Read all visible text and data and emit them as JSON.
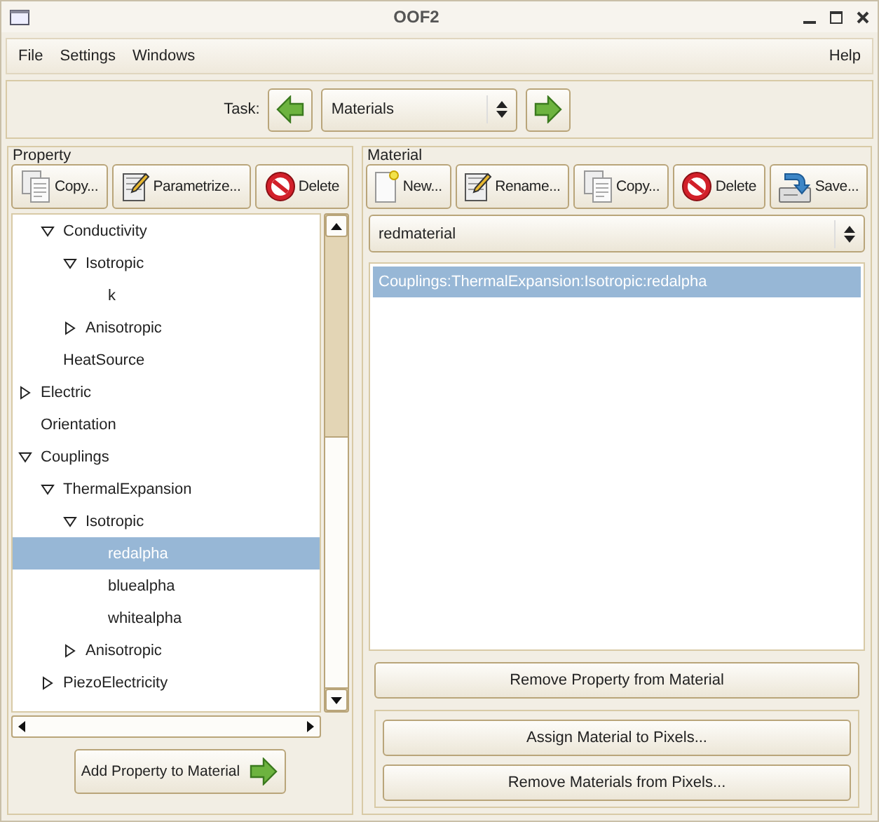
{
  "window": {
    "title": "OOF2"
  },
  "menu": {
    "left": [
      "File",
      "Settings",
      "Windows"
    ],
    "right": [
      "Help"
    ]
  },
  "task": {
    "label": "Task:",
    "value": "Materials"
  },
  "property": {
    "title": "Property",
    "buttons": [
      {
        "label": "Copy...",
        "kind": "copy"
      },
      {
        "label": "Parametrize...",
        "kind": "edit"
      },
      {
        "label": "Delete",
        "kind": "delete"
      }
    ],
    "tree": [
      {
        "children": [
          {
            "label": "Conductivity",
            "expanded": true,
            "selected": false,
            "children": [
              {
                "label": "Isotropic",
                "expanded": true,
                "selected": false,
                "children": [
                  {
                    "label": "k",
                    "selected": false
                  }
                ]
              },
              {
                "label": "Anisotropic",
                "expanded": false,
                "selected": false
              }
            ]
          },
          {
            "label": "HeatSource",
            "selected": false
          }
        ]
      },
      {
        "label": "Electric",
        "expanded": false,
        "selected": false
      },
      {
        "label": "Orientation",
        "selected": false
      },
      {
        "label": "Couplings",
        "expanded": true,
        "selected": false,
        "children": [
          {
            "label": "ThermalExpansion",
            "expanded": true,
            "selected": false,
            "children": [
              {
                "label": "Isotropic",
                "expanded": true,
                "selected": false,
                "children": [
                  {
                    "label": "redalpha",
                    "selected": true
                  },
                  {
                    "label": "bluealpha",
                    "selected": false
                  },
                  {
                    "label": "whitealpha",
                    "selected": false
                  }
                ]
              },
              {
                "label": "Anisotropic",
                "expanded": false,
                "selected": false
              }
            ]
          },
          {
            "label": "PiezoElectricity",
            "expanded": false,
            "selected": false
          }
        ]
      }
    ],
    "add_button": "Add Property to Material"
  },
  "material": {
    "title": "Material",
    "buttons": [
      {
        "label": "New...",
        "kind": "new"
      },
      {
        "label": "Rename...",
        "kind": "edit"
      },
      {
        "label": "Copy...",
        "kind": "copy"
      },
      {
        "label": "Delete",
        "kind": "delete"
      },
      {
        "label": "Save...",
        "kind": "save"
      }
    ],
    "selector": "redmaterial",
    "properties": [
      {
        "label": "Couplings:ThermalExpansion:Isotropic:redalpha",
        "selected": true
      }
    ],
    "remove_button": "Remove Property from Material",
    "pixel_buttons": [
      "Assign Material to Pixels...",
      "Remove Materials from Pixels..."
    ]
  }
}
